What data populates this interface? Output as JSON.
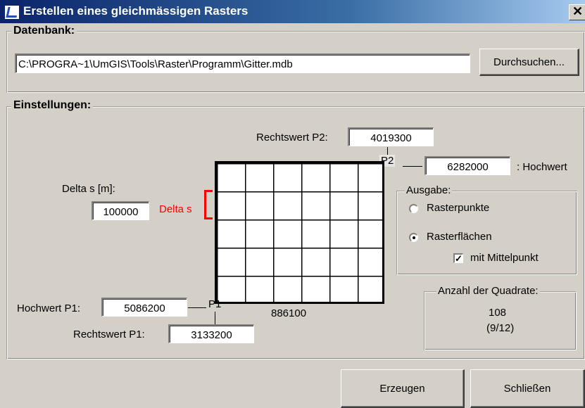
{
  "window": {
    "title": "Erstellen eines gleichmässigen Rasters",
    "close": "✕"
  },
  "datenbank": {
    "label": "Datenbank:",
    "path": "C:\\PROGRA~1\\UmGIS\\Tools\\Raster\\Programm\\Gitter.mdb",
    "browse_label": "Durchsuchen..."
  },
  "einstellungen": {
    "label": "Einstellungen:",
    "rechtswert_p2_label": "Rechtswert P2:",
    "rechtswert_p2": "4019300",
    "p2_label": "P2",
    "hochwert_p2": "6282000",
    "hochwert_suffix": ": Hochwert",
    "delta_label": "Delta s [m]:",
    "delta_value": "100000",
    "delta_marker": "Delta s",
    "p1_label": "P1",
    "hochwert_p1_label": "Hochwert P1:",
    "hochwert_p1": "5086200",
    "rechtswert_p1_label": "Rechtswert P1:",
    "rechtswert_p1": "3133200",
    "width_value": "886100"
  },
  "ausgabe": {
    "label": "Ausgabe:",
    "option_points": "Rasterpunkte",
    "option_areas": "Rasterflächen",
    "selected": "Rasterflächen",
    "centerpoint_label": "mit Mittelpunkt",
    "centerpoint_checked": true,
    "check_mark": "✓"
  },
  "anzahl": {
    "label": "Anzahl der Quadrate:",
    "count": "108",
    "dims": "(9/12)"
  },
  "buttons": {
    "create": "Erzeugen",
    "close": "Schließen"
  },
  "colors": {
    "delta_marker": "#ff0000",
    "titlebar": "#0a246a"
  }
}
